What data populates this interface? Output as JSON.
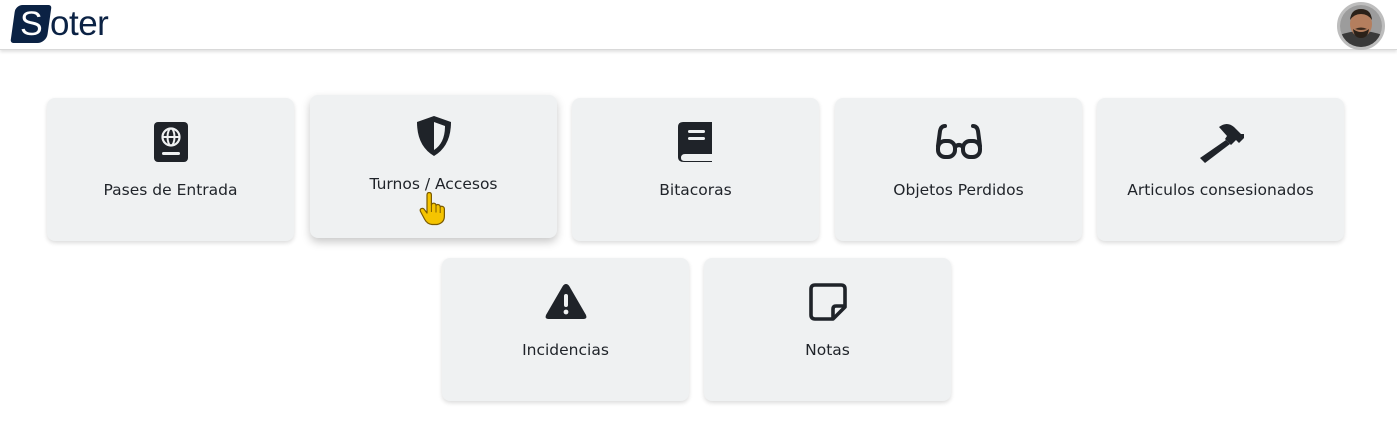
{
  "header": {
    "logo_mark": "S",
    "logo_rest": "oter",
    "avatar_alt": "user-avatar"
  },
  "cards": [
    {
      "label": "Pases de Entrada",
      "icon": "passport-icon"
    },
    {
      "label": "Turnos / Accesos",
      "icon": "shield-icon",
      "state": "hover"
    },
    {
      "label": "Bitacoras",
      "icon": "book-icon"
    },
    {
      "label": "Objetos Perdidos",
      "icon": "glasses-icon"
    },
    {
      "label": "Articulos consesionados",
      "icon": "hammer-icon"
    },
    {
      "label": "Incidencias",
      "icon": "warning-icon"
    },
    {
      "label": "Notas",
      "icon": "note-icon"
    }
  ],
  "colors": {
    "brand": "#0b2244",
    "card_bg": "#eff1f2",
    "icon": "#1f2329",
    "cursor": "#f5c400"
  }
}
